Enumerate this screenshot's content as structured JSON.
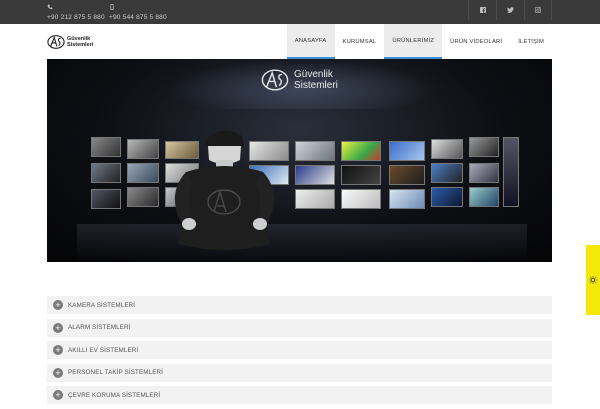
{
  "topbar": {
    "phone_icon": "phone-icon",
    "mobile_icon": "mobile-icon",
    "phone_number": "+90 212 875 5 880",
    "mobile_number": "+90 544 875 5 880",
    "social": [
      "facebook-icon",
      "twitter-icon",
      "instagram-icon"
    ]
  },
  "header": {
    "logo_line1": "Güvenlik",
    "logo_line2": "Sistemleri",
    "nav": [
      {
        "label": "ANASAYFA",
        "active": true
      },
      {
        "label": "KURUMSAL",
        "active": false
      },
      {
        "label": "ÜRÜNLERİMİZ",
        "active": true
      },
      {
        "label": "ÜRÜN VİDEOLARI",
        "active": false
      },
      {
        "label": "İLETİŞİM",
        "active": false
      }
    ]
  },
  "hero": {
    "logo_line1": "Güvenlik",
    "logo_line2": "Sistemleri"
  },
  "accordion": [
    "KAMERA SİSTEMLERİ",
    "ALARM SİSTEMLERİ",
    "AKILLI EV SİSTEMLERİ",
    "PERSONEL TAKİP SİSTEMLERİ",
    "ÇEVRE KORUMA SİSTEMLERİ"
  ],
  "colors": {
    "topbar": "#3a3a3a",
    "nav_active_border": "#3a8fd8",
    "side_widget": "#f2e90a"
  }
}
